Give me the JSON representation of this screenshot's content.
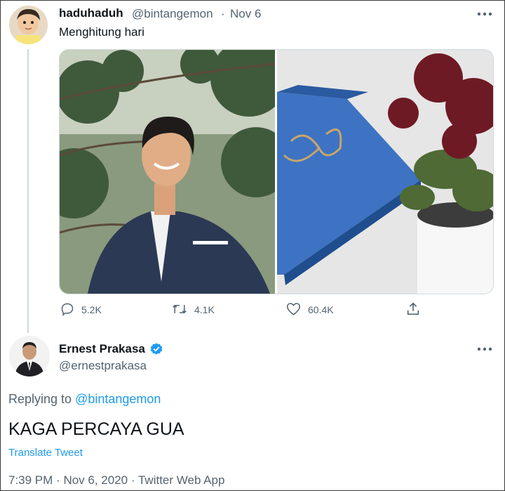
{
  "tweet": {
    "display_name": "haduhaduh",
    "handle": "@bintangemon",
    "separator": "·",
    "date": "Nov 6",
    "text": "Menghitung hari",
    "more_icon": "more-horizontal-icon",
    "actions": {
      "reply_count": "5.2K",
      "retweet_count": "4.1K",
      "like_count": "60.4K"
    }
  },
  "reply": {
    "display_name": "Ernest Prakasa",
    "verified": true,
    "handle": "@ernestprakasa",
    "replying_prefix": "Replying to",
    "replying_to": "@bintangemon",
    "text": "KAGA PERCAYA GUA",
    "translate_label": "Translate Tweet",
    "time": "7:39 PM",
    "sep": "·",
    "date": "Nov 6, 2020",
    "source": "Twitter Web App"
  },
  "colors": {
    "accent": "#1d9bf0",
    "secondary_text": "#536471",
    "primary_text": "#0f1419"
  }
}
